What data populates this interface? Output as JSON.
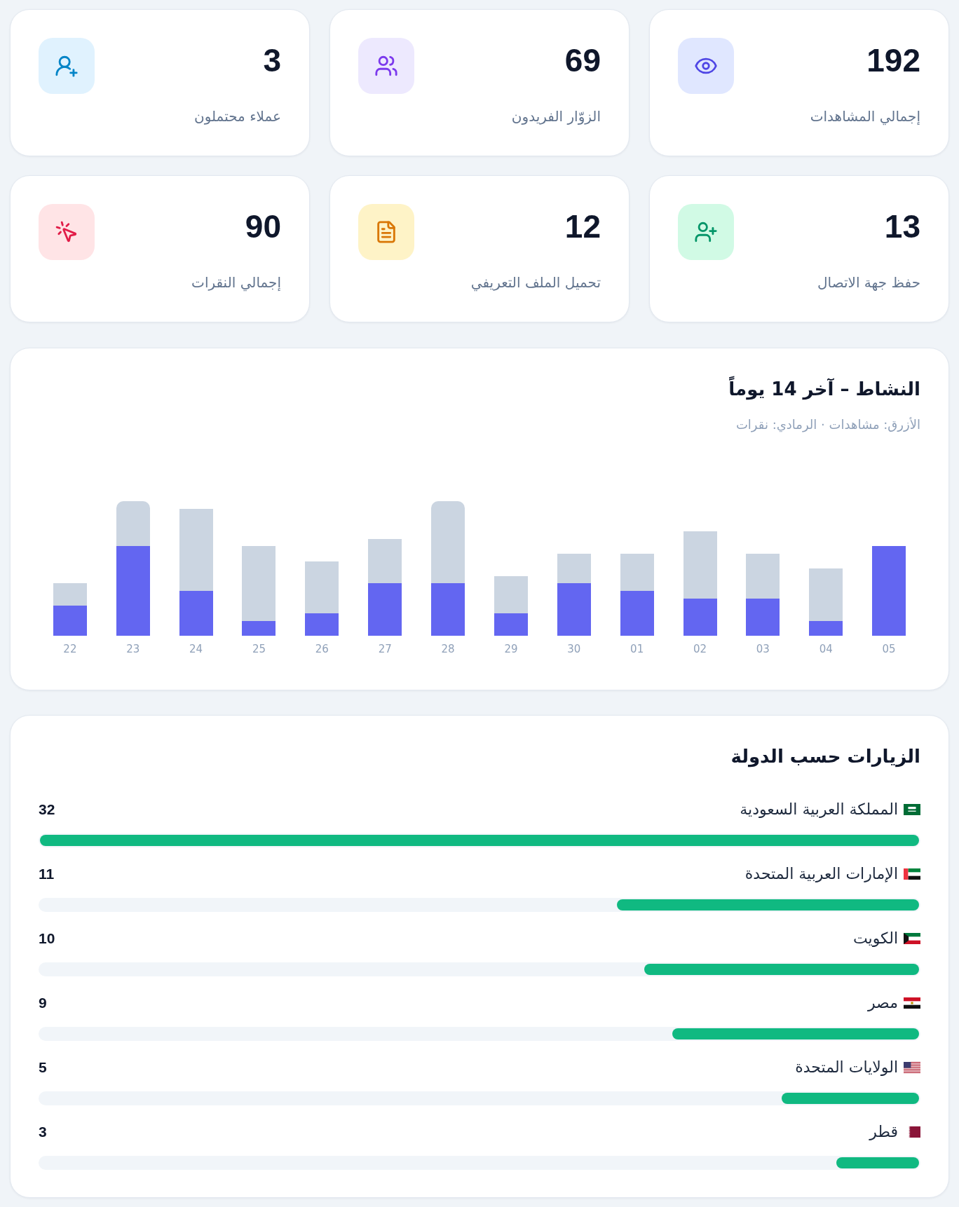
{
  "stats": [
    {
      "value": "192",
      "label": "إجمالي المشاهدات"
    },
    {
      "value": "69",
      "label": "الزوّار الفريدون"
    },
    {
      "value": "3",
      "label": "عملاء محتملون"
    },
    {
      "value": "13",
      "label": "حفظ جهة الاتصال"
    },
    {
      "value": "12",
      "label": "تحميل الملف التعريفي"
    },
    {
      "value": "90",
      "label": "إجمالي النقرات"
    }
  ],
  "activity": {
    "title": "النشاط – آخر 14 يوماً",
    "legend": "الأزرق: مشاهدات · الرمادي: نقرات",
    "days": [
      "05",
      "04",
      "03",
      "02",
      "01",
      "30",
      "29",
      "28",
      "27",
      "26",
      "25",
      "24",
      "23",
      "22"
    ]
  },
  "countries": {
    "title": "الزيارات حسب الدولة",
    "rows": [
      {
        "name": "المملكة العربية السعودية",
        "count": "32",
        "level": 1
      },
      {
        "name": "الإمارات العربية المتحدة",
        "count": "11",
        "level": 0.344
      },
      {
        "name": "الكويت",
        "count": "10",
        "level": 0.313
      },
      {
        "name": "مصر",
        "count": "9",
        "level": 0.281
      },
      {
        "name": "الولايات المتحدة",
        "count": "5",
        "level": 0.156
      },
      {
        "name": "قطر",
        "count": "3",
        "level": 0.094
      }
    ]
  }
}
